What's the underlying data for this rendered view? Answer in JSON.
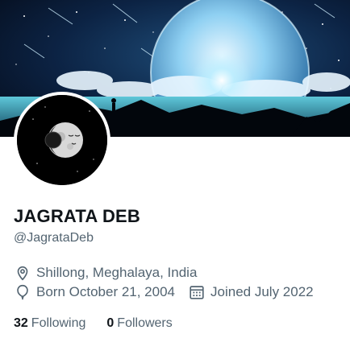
{
  "profile": {
    "name": "JAGRATA DEB",
    "handle": "@JagrataDeb",
    "location": "Shillong, Meghalaya, India",
    "born": "Born October 21, 2004",
    "joined": "Joined July 2022"
  },
  "stats": {
    "following_count": "32",
    "following_label": "Following",
    "followers_count": "0",
    "followers_label": "Followers"
  },
  "icons": {
    "location": "location-pin-icon",
    "birthday": "balloon-icon",
    "joined": "calendar-icon"
  },
  "colors": {
    "text_primary": "#0f1419",
    "text_secondary": "#536471",
    "banner_sky": "#0a1830"
  }
}
